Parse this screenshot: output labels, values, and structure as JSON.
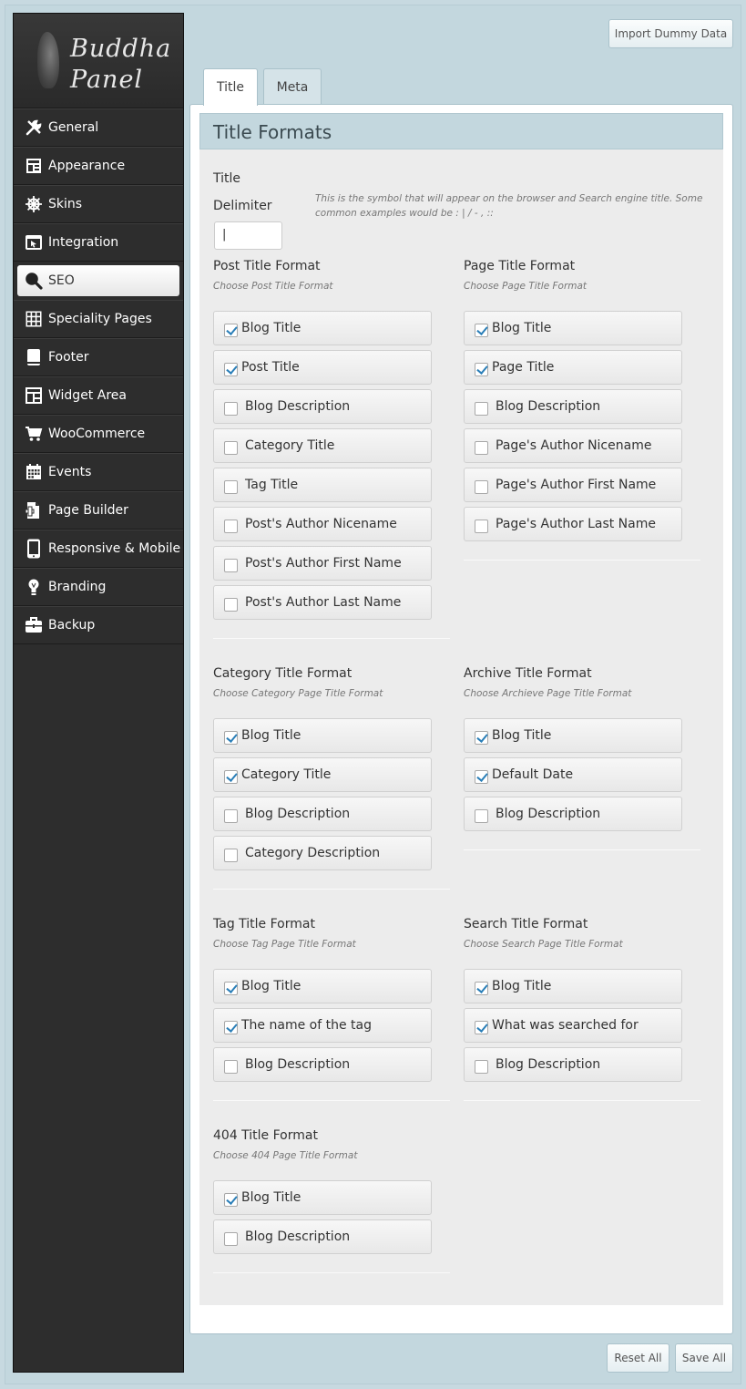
{
  "brand": {
    "line1": "Buddha",
    "line2": "Panel"
  },
  "sidebar": {
    "items": [
      {
        "label": "General",
        "icon": "wrench-icon",
        "active": false
      },
      {
        "label": "Appearance",
        "icon": "layout-icon",
        "active": false
      },
      {
        "label": "Skins",
        "icon": "helm-icon",
        "active": false
      },
      {
        "label": "Integration",
        "icon": "integration-icon",
        "active": false
      },
      {
        "label": "SEO",
        "icon": "search-icon",
        "active": true
      },
      {
        "label": "Speciality Pages",
        "icon": "grid-icon",
        "active": false
      },
      {
        "label": "Footer",
        "icon": "footer-icon",
        "active": false
      },
      {
        "label": "Widget Area",
        "icon": "widget-icon",
        "active": false
      },
      {
        "label": "WooCommerce",
        "icon": "cart-icon",
        "active": false
      },
      {
        "label": "Events",
        "icon": "calendar-icon",
        "active": false
      },
      {
        "label": "Page Builder",
        "icon": "page-builder-icon",
        "active": false
      },
      {
        "label": "Responsive & Mobile",
        "icon": "mobile-icon",
        "active": false
      },
      {
        "label": "Branding",
        "icon": "lightbulb-icon",
        "active": false
      },
      {
        "label": "Backup",
        "icon": "briefcase-icon",
        "active": false
      }
    ]
  },
  "toolbar": {
    "import_label": "Import Dummy Data",
    "reset_label": "Reset All",
    "save_label": "Save All"
  },
  "tabs": [
    {
      "label": "Title",
      "active": true
    },
    {
      "label": "Meta",
      "active": false
    }
  ],
  "section": {
    "title": "Title Formats"
  },
  "delimiter": {
    "label_line1": "Title",
    "label_line2": "Delimiter",
    "value": "|",
    "description": "This is the symbol that will appear on the browser and Search engine title. Some common examples would be : | / - , ::"
  },
  "groups": {
    "post": {
      "title": "Post Title Format",
      "subtitle": "Choose Post Title Format",
      "options": [
        {
          "label": "Blog Title",
          "checked": true
        },
        {
          "label": "Post Title",
          "checked": true
        },
        {
          "label": "Blog Description",
          "checked": false
        },
        {
          "label": "Category Title",
          "checked": false
        },
        {
          "label": "Tag Title",
          "checked": false
        },
        {
          "label": "Post's Author Nicename",
          "checked": false
        },
        {
          "label": "Post's Author First Name",
          "checked": false
        },
        {
          "label": "Post's Author Last Name",
          "checked": false
        }
      ]
    },
    "page": {
      "title": "Page Title Format",
      "subtitle": "Choose Page Title Format",
      "options": [
        {
          "label": "Blog Title",
          "checked": true
        },
        {
          "label": "Page Title",
          "checked": true
        },
        {
          "label": "Blog Description",
          "checked": false
        },
        {
          "label": "Page's Author Nicename",
          "checked": false
        },
        {
          "label": "Page's Author First Name",
          "checked": false
        },
        {
          "label": "Page's Author Last Name",
          "checked": false
        }
      ]
    },
    "category": {
      "title": "Category Title Format",
      "subtitle": "Choose Category Page Title Format",
      "options": [
        {
          "label": "Blog Title",
          "checked": true
        },
        {
          "label": "Category Title",
          "checked": true
        },
        {
          "label": "Blog Description",
          "checked": false
        },
        {
          "label": "Category Description",
          "checked": false
        }
      ]
    },
    "archive": {
      "title": "Archive Title Format",
      "subtitle": "Choose Archieve Page Title Format",
      "options": [
        {
          "label": "Blog Title",
          "checked": true
        },
        {
          "label": "Default Date",
          "checked": true
        },
        {
          "label": "Blog Description",
          "checked": false
        }
      ]
    },
    "tag": {
      "title": "Tag Title Format",
      "subtitle": "Choose Tag Page Title Format",
      "options": [
        {
          "label": "Blog Title",
          "checked": true
        },
        {
          "label": "The name of the tag",
          "checked": true
        },
        {
          "label": "Blog Description",
          "checked": false
        }
      ]
    },
    "search": {
      "title": "Search Title Format",
      "subtitle": "Choose Search Page Title Format",
      "options": [
        {
          "label": "Blog Title",
          "checked": true
        },
        {
          "label": "What was searched for",
          "checked": true
        },
        {
          "label": "Blog Description",
          "checked": false
        }
      ]
    },
    "notfound": {
      "title": "404 Title Format",
      "subtitle": "Choose 404 Page Title Format",
      "options": [
        {
          "label": "Blog Title",
          "checked": true
        },
        {
          "label": "Blog Description",
          "checked": false
        }
      ]
    }
  }
}
